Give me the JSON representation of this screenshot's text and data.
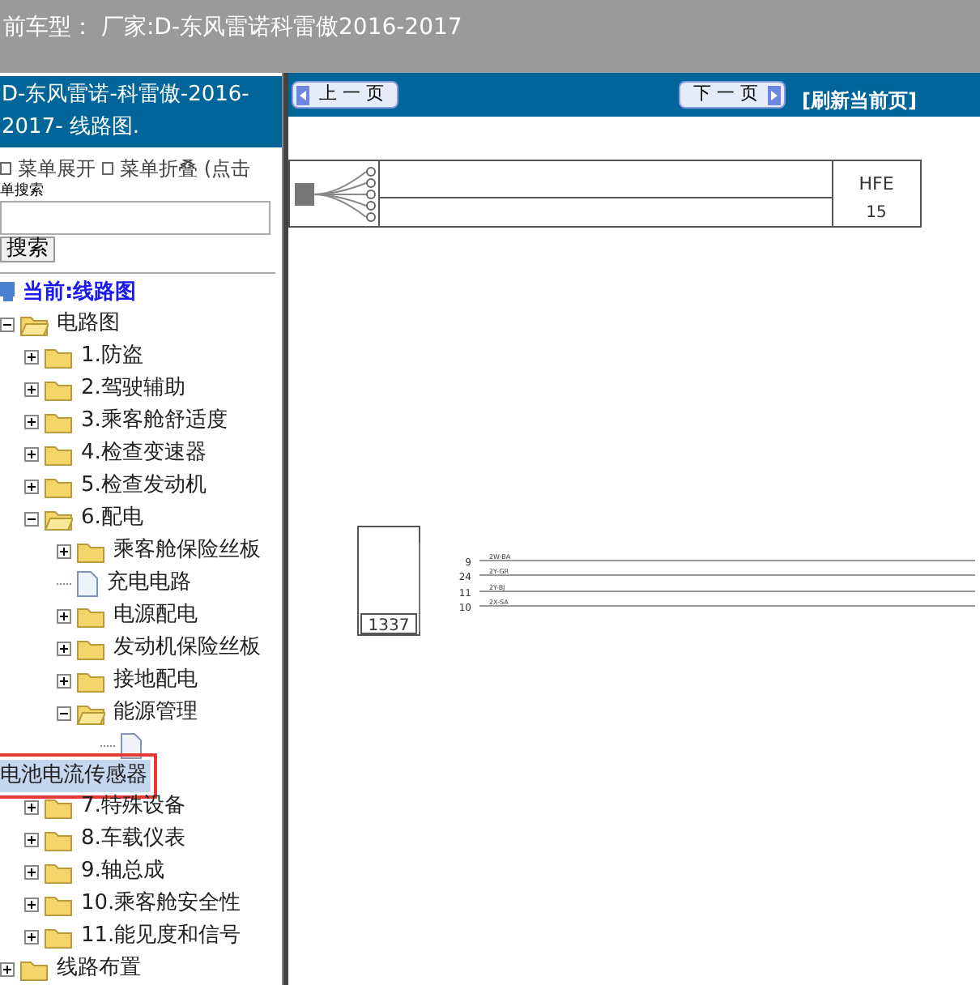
{
  "header": {
    "title": "前车型：  厂家:D-东风雷诺科雷傲2016-2017"
  },
  "sidebar": {
    "title": "D-东风雷诺-科雷傲-2016-2017- 线路图.",
    "menu_links": [
      "菜单展开",
      "菜单折叠 (点击"
    ],
    "search_label": "单搜索",
    "search_button": "搜索",
    "current": "当前:线路图",
    "tree": [
      {
        "label": "电路图",
        "kind": "folder",
        "expanded": true,
        "selected": false,
        "children": [
          {
            "label": "1.防盗",
            "kind": "folder",
            "expanded": false,
            "selected": false
          },
          {
            "label": "2.驾驶辅助",
            "kind": "folder",
            "expanded": false,
            "selected": false
          },
          {
            "label": "3.乘客舱舒适度",
            "kind": "folder",
            "expanded": false,
            "selected": false
          },
          {
            "label": "4.检查变速器",
            "kind": "folder",
            "expanded": false,
            "selected": false
          },
          {
            "label": "5.检查发动机",
            "kind": "folder",
            "expanded": false,
            "selected": false
          },
          {
            "label": "6.配电",
            "kind": "folder",
            "expanded": true,
            "selected": false,
            "children": [
              {
                "label": "乘客舱保险丝板",
                "kind": "folder",
                "expanded": false,
                "selected": false
              },
              {
                "label": "充电电路",
                "kind": "file",
                "selected": false
              },
              {
                "label": "电源配电",
                "kind": "folder",
                "expanded": false,
                "selected": false
              },
              {
                "label": "发动机保险丝板",
                "kind": "folder",
                "expanded": false,
                "selected": false
              },
              {
                "label": "接地配电",
                "kind": "folder",
                "expanded": false,
                "selected": false
              },
              {
                "label": "能源管理",
                "kind": "folder",
                "expanded": true,
                "selected": false,
                "children": [
                  {
                    "label": "电池电流传感器",
                    "kind": "file",
                    "selected": true
                  }
                ]
              }
            ]
          },
          {
            "label": "7.特殊设备",
            "kind": "folder",
            "expanded": false,
            "selected": false
          },
          {
            "label": "8.车载仪表",
            "kind": "folder",
            "expanded": false,
            "selected": false
          },
          {
            "label": "9.轴总成",
            "kind": "folder",
            "expanded": false,
            "selected": false
          },
          {
            "label": "10.乘客舱安全性",
            "kind": "folder",
            "expanded": false,
            "selected": false
          },
          {
            "label": "11.能见度和信号",
            "kind": "folder",
            "expanded": false,
            "selected": false
          }
        ]
      },
      {
        "label": "线路布置",
        "kind": "folder",
        "expanded": false,
        "selected": false
      }
    ]
  },
  "toolbar": {
    "prev": "上 一 页",
    "next": "下 一 页",
    "refresh": "[刷新当前页]"
  },
  "diagram": {
    "connector": {
      "code": "HFE",
      "number": "15"
    },
    "component": {
      "number": "1337",
      "pins": [
        {
          "pin": "9",
          "wire": "2W-BA"
        },
        {
          "pin": "24",
          "wire": "2Y-GR"
        },
        {
          "pin": "11",
          "wire": "2Y-BJ"
        },
        {
          "pin": "10",
          "wire": "2X-SA"
        }
      ]
    }
  }
}
